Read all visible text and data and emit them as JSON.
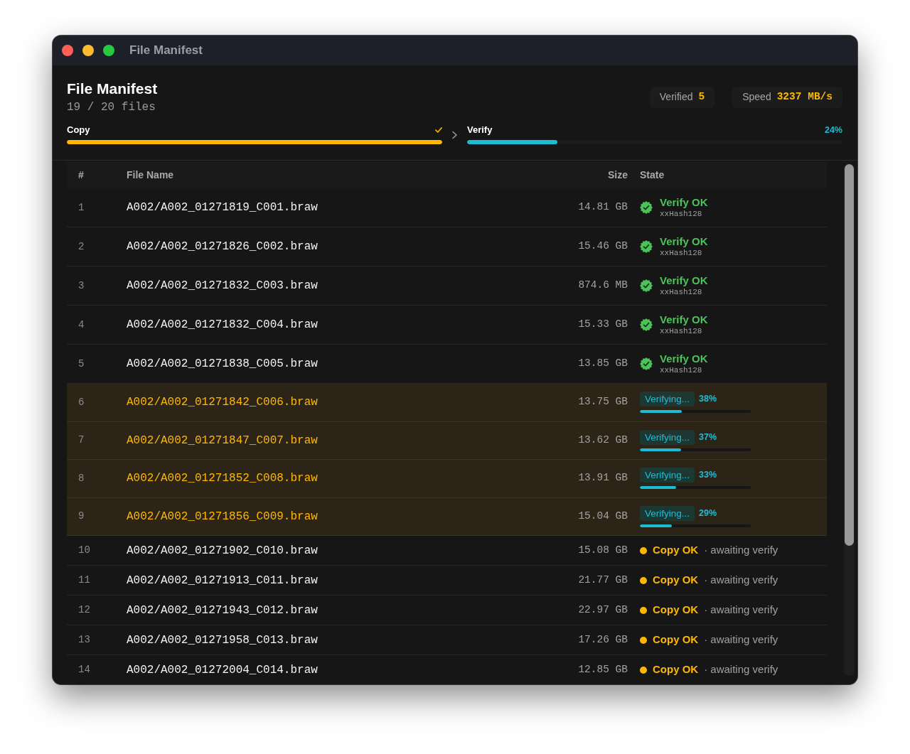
{
  "window": {
    "title": "File Manifest"
  },
  "header": {
    "title": "File Manifest",
    "subtitle": "19 / 20 files",
    "stats": [
      {
        "label": "Verified",
        "value": "5"
      },
      {
        "label": "Speed",
        "value": "3237 MB/s"
      }
    ]
  },
  "stages": [
    {
      "label": "Copy",
      "done": true,
      "level": 1,
      "color": "#ffb800"
    },
    {
      "label": "Verify",
      "done": false,
      "level": 0.24,
      "reading": "24%",
      "color": "#1bbcd6"
    }
  ],
  "table": {
    "columns": [
      "#",
      "File Name",
      "Size",
      "State"
    ],
    "rows": [
      {
        "index": "1",
        "file": "A002/A002_01271819_C001.braw",
        "size": "14.81 GB",
        "kind": "verified",
        "status": "Verify OK",
        "detail": "xxHash128"
      },
      {
        "index": "2",
        "file": "A002/A002_01271826_C002.braw",
        "size": "15.46 GB",
        "kind": "verified",
        "status": "Verify OK",
        "detail": "xxHash128"
      },
      {
        "index": "3",
        "file": "A002/A002_01271832_C003.braw",
        "size": "874.6 MB",
        "kind": "verified",
        "status": "Verify OK",
        "detail": "xxHash128"
      },
      {
        "index": "4",
        "file": "A002/A002_01271832_C004.braw",
        "size": "15.33 GB",
        "kind": "verified",
        "status": "Verify OK",
        "detail": "xxHash128"
      },
      {
        "index": "5",
        "file": "A002/A002_01271838_C005.braw",
        "size": "13.85 GB",
        "kind": "verified",
        "status": "Verify OK",
        "detail": "xxHash128"
      },
      {
        "index": "6",
        "file": "A002/A002_01271842_C006.braw",
        "size": "13.75 GB",
        "kind": "verifying",
        "status": "Verifying...",
        "reading": "38%",
        "level": 0.38
      },
      {
        "index": "7",
        "file": "A002/A002_01271847_C007.braw",
        "size": "13.62 GB",
        "kind": "verifying",
        "status": "Verifying...",
        "reading": "37%",
        "level": 0.37
      },
      {
        "index": "8",
        "file": "A002/A002_01271852_C008.braw",
        "size": "13.91 GB",
        "kind": "verifying",
        "status": "Verifying...",
        "reading": "33%",
        "level": 0.33
      },
      {
        "index": "9",
        "file": "A002/A002_01271856_C009.braw",
        "size": "15.04 GB",
        "kind": "verifying",
        "status": "Verifying...",
        "reading": "29%",
        "level": 0.29
      },
      {
        "index": "10",
        "file": "A002/A002_01271902_C010.braw",
        "size": "15.08 GB",
        "kind": "copied",
        "status": "Copy OK",
        "detail": "· awaiting verify"
      },
      {
        "index": "11",
        "file": "A002/A002_01271913_C011.braw",
        "size": "21.77 GB",
        "kind": "copied",
        "status": "Copy OK",
        "detail": "· awaiting verify"
      },
      {
        "index": "12",
        "file": "A002/A002_01271943_C012.braw",
        "size": "22.97 GB",
        "kind": "copied",
        "status": "Copy OK",
        "detail": "· awaiting verify"
      },
      {
        "index": "13",
        "file": "A002/A002_01271958_C013.braw",
        "size": "17.26 GB",
        "kind": "copied",
        "status": "Copy OK",
        "detail": "· awaiting verify"
      },
      {
        "index": "14",
        "file": "A002/A002_01272004_C014.braw",
        "size": "12.85 GB",
        "kind": "copied",
        "status": "Copy OK",
        "detail": "· awaiting verify"
      }
    ]
  }
}
